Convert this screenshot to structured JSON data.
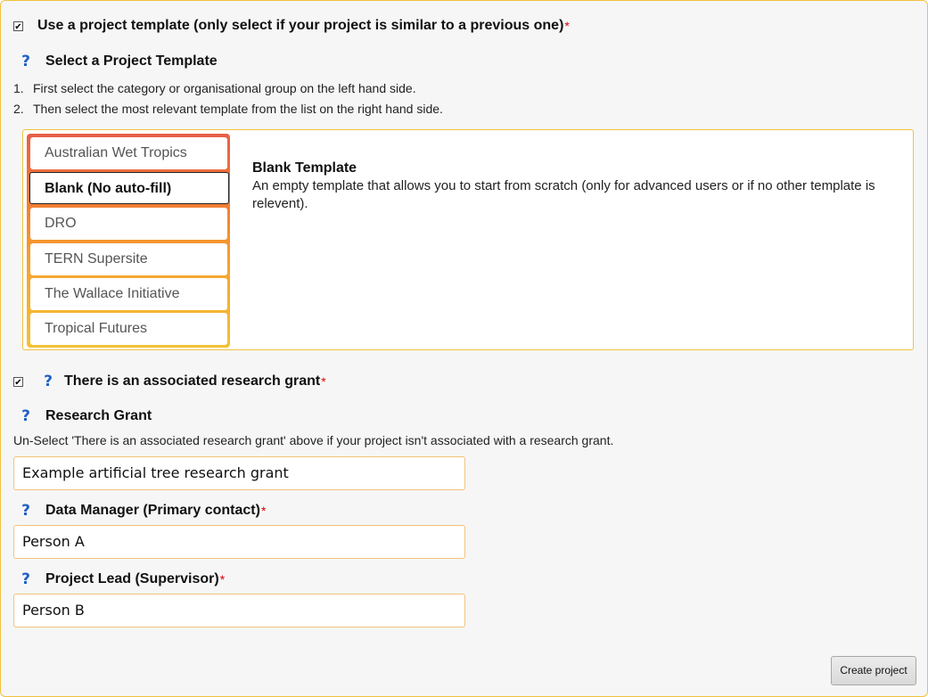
{
  "use_template": {
    "checked": "✔",
    "label": "Use a project template (only select if your project is similar to a previous one)",
    "required": "*"
  },
  "select_template": {
    "title": "Select a Project Template",
    "help": "?",
    "steps": [
      {
        "num": "1.",
        "text": "First select the category or organisational group on the left hand side."
      },
      {
        "num": "2.",
        "text": "Then select the most relevant template from the list on the right hand side."
      }
    ]
  },
  "templates": {
    "items": [
      "Australian Wet Tropics",
      "Blank (No auto-fill)",
      "DRO",
      "TERN Supersite",
      "The Wallace Initiative",
      "Tropical Futures"
    ],
    "selected_index": 1,
    "detail": {
      "name": "Blank Template",
      "description": "An empty template that allows you to start from scratch (only for advanced users or if no other template is relevent)."
    }
  },
  "grant_check": {
    "checked": "✔",
    "help": "?",
    "label": "There is an associated research grant",
    "required": "*"
  },
  "research_grant": {
    "help": "?",
    "label": "Research Grant",
    "note": "Un-Select 'There is an associated research grant' above if your project isn't associated with a research grant.",
    "value": "Example artificial tree research grant"
  },
  "data_manager": {
    "help": "?",
    "label": "Data Manager (Primary contact)",
    "required": "*",
    "value": "Person A"
  },
  "project_lead": {
    "help": "?",
    "label": "Project Lead (Supervisor)",
    "required": "*",
    "value": "Person B"
  },
  "actions": {
    "create_label": "Create project"
  }
}
